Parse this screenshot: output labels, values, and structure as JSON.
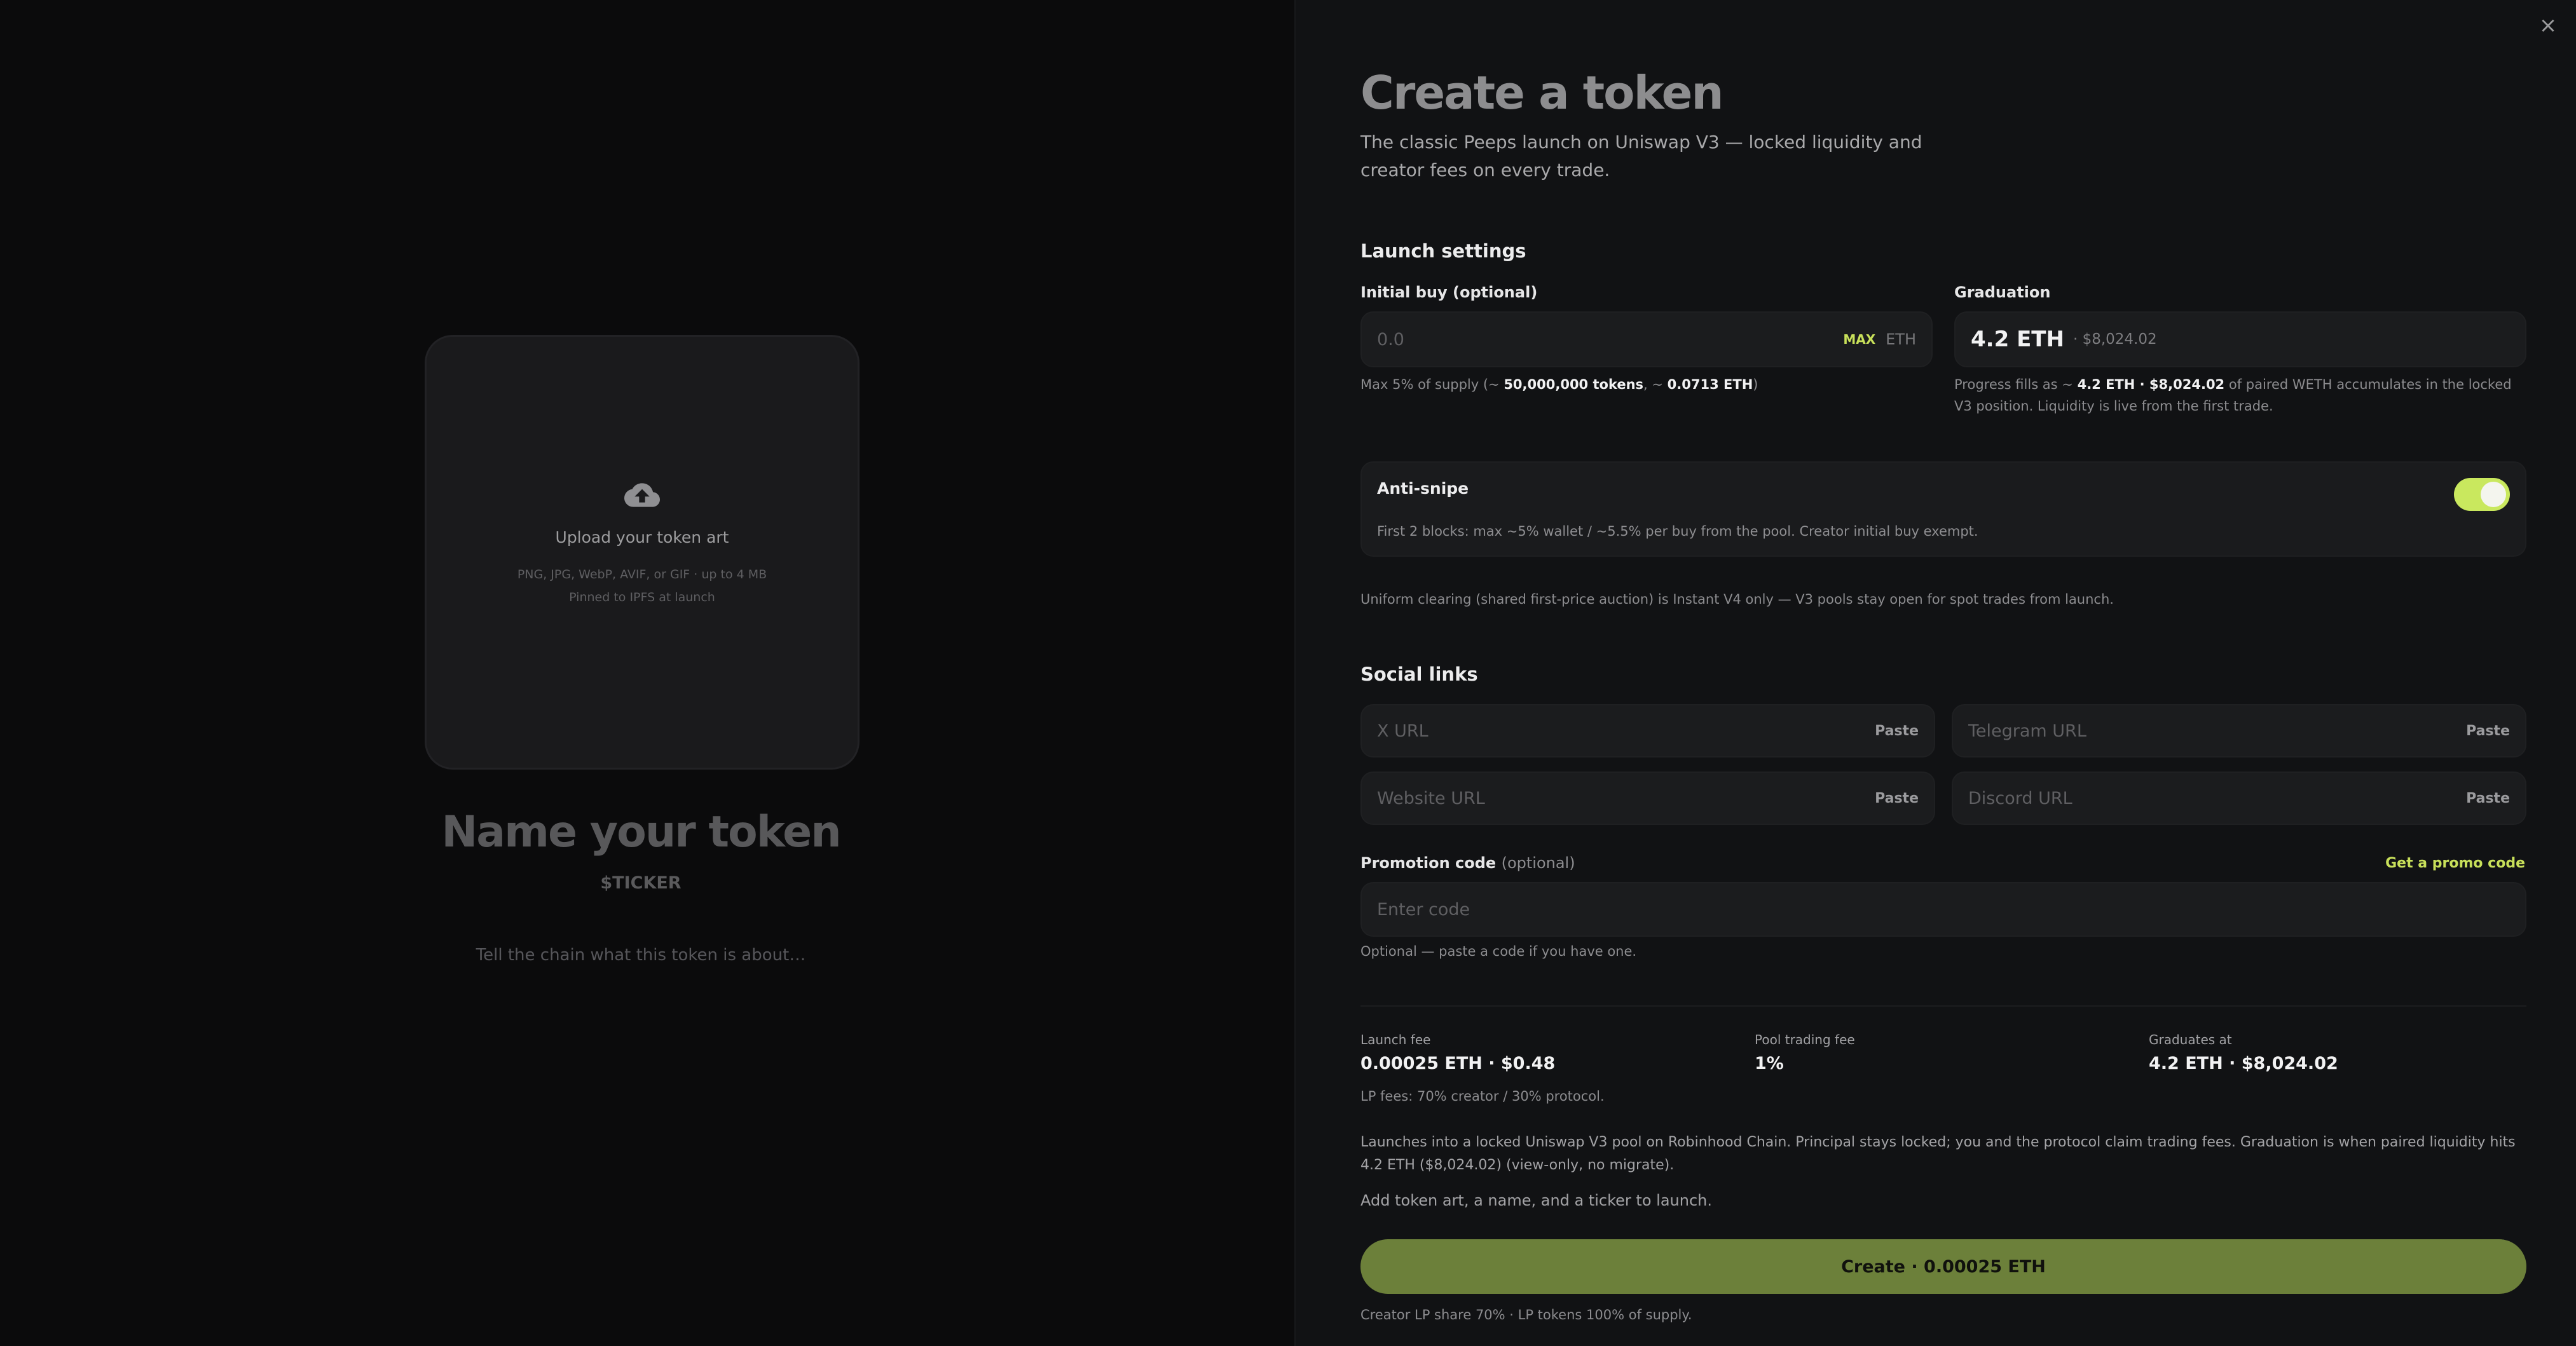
{
  "preview": {
    "upload_title": "Upload your token art",
    "upload_formats": "PNG, JPG, WebP, AVIF, or GIF · up to 4 MB",
    "upload_pinned": "Pinned to IPFS at launch",
    "name_placeholder": "Name your token",
    "ticker_placeholder": "$TICKER",
    "description_placeholder": "Tell the chain what this token is about…"
  },
  "panel": {
    "close_symbol": "×",
    "title": "Create a token",
    "description": "The classic Peeps launch on Uniswap V3 — locked liquidity and creator fees on every trade."
  },
  "launch_settings": {
    "section_title": "Launch settings",
    "initial_buy": {
      "label": "Initial buy (optional)",
      "placeholder": "0.0",
      "max_label": "MAX",
      "unit": "ETH",
      "hint_prefix": "Max 5% of supply (~ ",
      "hint_tokens": "50,000,000 tokens",
      "hint_mid": ", ~ ",
      "hint_eth": "0.0713 ETH",
      "hint_suffix": ")"
    },
    "graduation": {
      "label": "Graduation",
      "value": "4.2 ETH",
      "usd": "· $8,024.02",
      "hint_prefix": "Progress fills as ~ ",
      "hint_bold": "4.2 ETH · $8,024.02",
      "hint_suffix": " of paired WETH accumulates in the locked V3 position. Liquidity is live from the first trade."
    },
    "anti_snipe": {
      "title": "Anti-snipe",
      "description": "First 2 blocks: max ~5% wallet / ~5.5% per buy from the pool. Creator initial buy exempt.",
      "enabled": true
    },
    "clearing_note": "Uniform clearing (shared first-price auction) is Instant V4 only — V3 pools stay open for spot trades from launch."
  },
  "social_links": {
    "section_title": "Social links",
    "paste_label": "Paste",
    "x_placeholder": "X URL",
    "telegram_placeholder": "Telegram URL",
    "website_placeholder": "Website URL",
    "discord_placeholder": "Discord URL"
  },
  "promotion": {
    "label": "Promotion code",
    "label_optional": "(optional)",
    "link": "Get a promo code",
    "placeholder": "Enter code",
    "hint": "Optional — paste a code if you have one."
  },
  "fees": {
    "launch_fee_label": "Launch fee",
    "launch_fee_value": "0.00025 ETH · $0.48",
    "pool_fee_label": "Pool trading fee",
    "pool_fee_value": "1%",
    "graduates_label": "Graduates at",
    "graduates_value": "4.2 ETH · $8,024.02",
    "lp_fees": "LP fees: 70% creator / 30% protocol.",
    "summary": "Launches into a locked Uniswap V3 pool on Robinhood Chain. Principal stays locked; you and the protocol claim trading fees. Graduation is when paired liquidity hits 4.2 ETH ($8,024.02) (view-only, no migrate).",
    "requirement": "Add token art, a name, and a ticker to launch.",
    "create_button": "Create · 0.00025 ETH",
    "footer": "Creator LP share 70% · LP tokens 100% of supply."
  },
  "colors": {
    "accent": "#c8e05a",
    "create_button": "#6c803a",
    "panel_bg": "#111214",
    "preview_bg": "#0b0b0c"
  }
}
